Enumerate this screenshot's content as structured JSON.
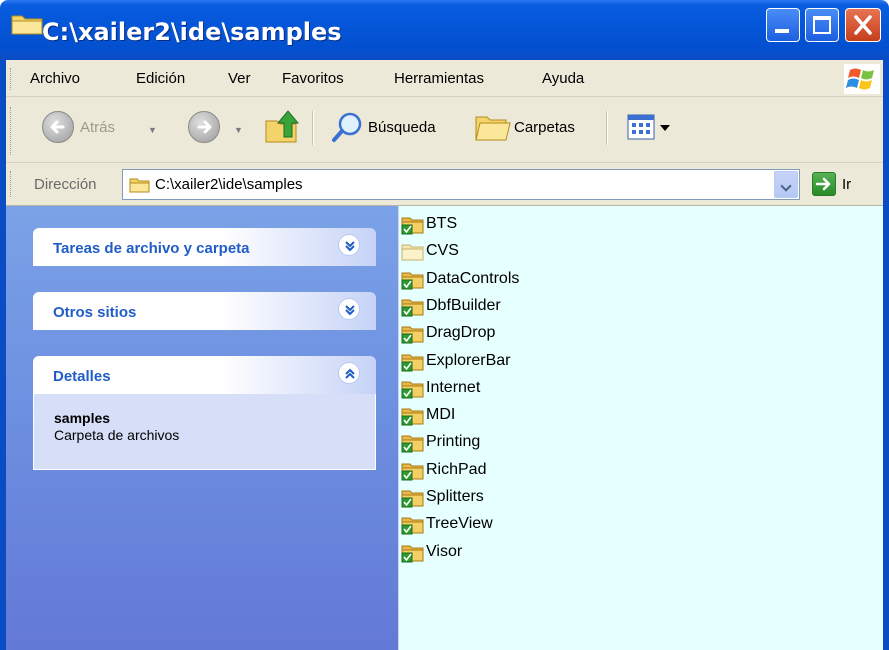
{
  "window": {
    "title": "C:\\xailer2\\ide\\samples",
    "controls": [
      "minimize",
      "maximize",
      "close"
    ]
  },
  "menu": {
    "items": [
      "Archivo",
      "Edición",
      "Ver",
      "Favoritos",
      "Herramientas",
      "Ayuda"
    ]
  },
  "toolbar": {
    "back_label": "Atrás",
    "search_label": "Búsqueda",
    "folders_label": "Carpetas"
  },
  "address": {
    "label": "Dirección",
    "value": "C:\\xailer2\\ide\\samples",
    "go_label": "Ir"
  },
  "tasks": {
    "panels": [
      {
        "title": "Tareas de archivo y carpeta",
        "expanded": false
      },
      {
        "title": "Otros sitios",
        "expanded": false
      },
      {
        "title": "Detalles",
        "expanded": true
      }
    ],
    "details": {
      "name": "samples",
      "type": "Carpeta de archivos"
    }
  },
  "files": [
    {
      "name": "BTS",
      "shared": true
    },
    {
      "name": "CVS",
      "shared": false
    },
    {
      "name": "DataControls",
      "shared": true
    },
    {
      "name": "DbfBuilder",
      "shared": true
    },
    {
      "name": "DragDrop",
      "shared": true
    },
    {
      "name": "ExplorerBar",
      "shared": true
    },
    {
      "name": "Internet",
      "shared": true
    },
    {
      "name": "MDI",
      "shared": true
    },
    {
      "name": "Printing",
      "shared": true
    },
    {
      "name": "RichPad",
      "shared": true
    },
    {
      "name": "Splitters",
      "shared": true
    },
    {
      "name": "TreeView",
      "shared": true
    },
    {
      "name": "Visor",
      "shared": true
    }
  ],
  "colors": {
    "titlebar": "#0455d8",
    "chrome": "#ece9d8",
    "taskpane": "#6c8ee0",
    "panel_title": "#215dc6",
    "file_area": "#e6ffff"
  }
}
